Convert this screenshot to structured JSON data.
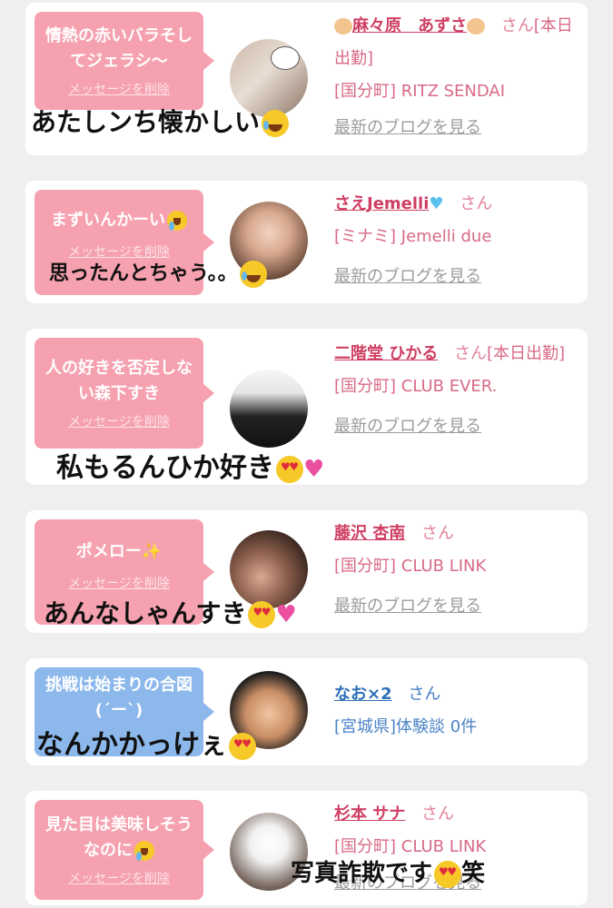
{
  "colors": {
    "pink_bubble": "#f6a1af",
    "blue_bubble": "#8cb8ec",
    "pink_name": "#cf3f63",
    "blue_name": "#2e6fb7",
    "blog_link": "#9b9b9b"
  },
  "delete_label": "メッセージを削除",
  "blog_label": "最新のブログを見る",
  "honorific": "さん",
  "cards": [
    {
      "message": "情熱の赤いバラそしてジェラシ〜",
      "name": "麻々原　あずさ",
      "name_decoration": "hamster-icon",
      "status": "[本日出勤]",
      "shop": "[国分町] RITZ SENDAI",
      "overlay": "あたしンち懐かしい",
      "overlay_emoji": "joy-emoji"
    },
    {
      "message": "まずいんかーい",
      "message_emoji": "joy-emoji",
      "name": "さえJemelli",
      "name_decoration": "blue-heart-icon",
      "shop": "[ミナミ] Jemelli due",
      "overlay": "思ったんとちゃう。。",
      "overlay_emoji": "joy-emoji"
    },
    {
      "message": "人の好きを否定しない森下すき",
      "name": "二階堂 ひかる",
      "status": "[本日出勤]",
      "shop": "[国分町] CLUB EVER.",
      "overlay": "私もるんひか好き",
      "overlay_emoji": "heart-eyes-emoji"
    },
    {
      "message": "ポメロー",
      "message_emoji": "sparkles-emoji",
      "name": "藤沢 杏南",
      "shop": "[国分町] CLUB LINK",
      "overlay": "あんなしゃんすき",
      "overlay_emoji": "heart-eyes-emoji"
    },
    {
      "message": "挑戦は始まりの合図(´ー`)",
      "name": "なお×2",
      "shop": "[宮城県]体験談 0件",
      "overlay": "なんかかっけぇ",
      "overlay_emoji": "heart-eyes-emoji"
    },
    {
      "message": "見た目は美味しそうなのに",
      "message_emoji": "joy-emoji",
      "name": "杉本 サナ",
      "shop": "[国分町] CLUB LINK",
      "overlay_a": "写真詐欺です",
      "overlay_b": "笑",
      "overlay_emoji": "heart-eyes-emoji"
    }
  ]
}
